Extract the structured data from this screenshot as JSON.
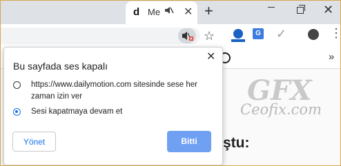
{
  "tab": {
    "favicon_letter": "d",
    "title": "Me"
  },
  "popup": {
    "title": "Bu sayfada ses kapalı",
    "option_allow": "https://www.dailymotion.com sitesinde sese her zaman izin ver",
    "option_keep_muted": "Sesi kapatmaya devam et",
    "selected_option": "option_keep_muted",
    "manage_label": "Yönet",
    "done_label": "Bitti",
    "close_glyph": "✕"
  },
  "page": {
    "heading_fragment": "ştu:",
    "watermark_text": "Ceofix.com",
    "watermark_logo": "GFX"
  },
  "toolbar": {
    "chevron_glyph": "»"
  },
  "colors": {
    "accent": "#1a73e8",
    "done_button": "#6fa0f2",
    "titlebar": "#dee1e6"
  }
}
